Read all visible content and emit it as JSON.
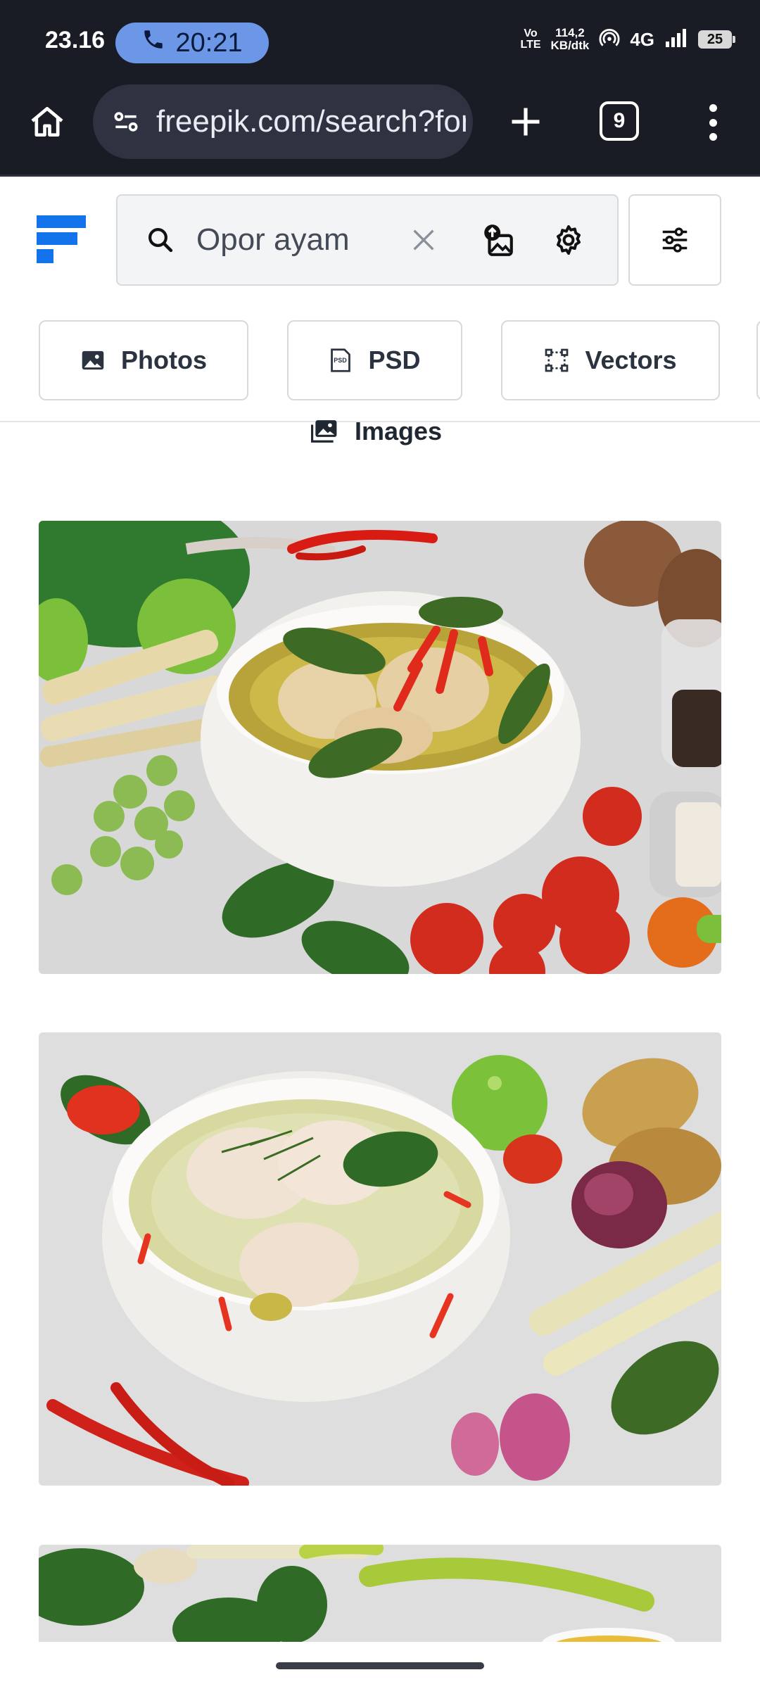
{
  "status_bar": {
    "time": "23.16",
    "call_timer": "20:21",
    "volte": "Vo LTE",
    "net_speed_value": "114,2",
    "net_speed_unit": "KB/dtk",
    "network_type": "4G",
    "battery": "25"
  },
  "browser": {
    "url": "freepik.com/search?format=search&query=Opor+ayam",
    "tab_count": "9"
  },
  "search": {
    "query": "Opor ayam"
  },
  "categories": [
    {
      "label": "Photos",
      "icon": "photo-icon"
    },
    {
      "label": "PSD",
      "icon": "psd-icon"
    },
    {
      "label": "Vectors",
      "icon": "vectors-icon"
    }
  ],
  "images_tab": {
    "label": "Images"
  },
  "results": [
    {
      "subject": "green curry chicken in white bowl with vegetables"
    },
    {
      "subject": "coconut chicken soup in white bowl with vegetables"
    },
    {
      "subject": "herbs and chilies on grey surface"
    }
  ],
  "colors": {
    "brand_blue": "#1273eb",
    "status_bar_bg": "#1a1c25",
    "call_pill": "#6b97e6"
  }
}
